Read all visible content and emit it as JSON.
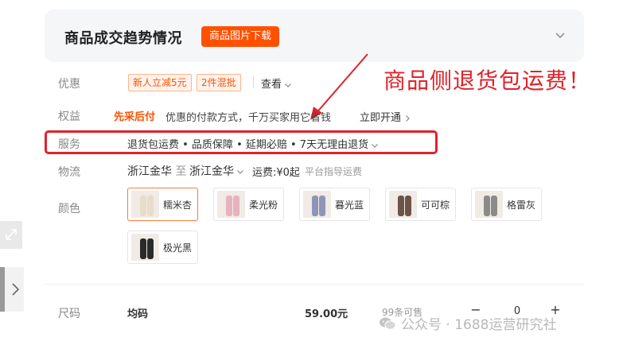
{
  "header": {
    "title": "商品成交趋势情况",
    "download_label": "商品图片下载"
  },
  "annotation": "商品侧退货包运费！",
  "rows": {
    "discount": {
      "label": "优惠",
      "tags": [
        "新人立减5元",
        "2件混批"
      ],
      "view_label": "查看"
    },
    "benefit": {
      "label": "权益",
      "name": "先采后付",
      "desc": "优惠的付款方式，千万买家用它省钱",
      "action": "立即开通"
    },
    "service": {
      "label": "服务",
      "text": "退货包运费 • 品质保障 • 延期必赔 • 7天无理由退货"
    },
    "logistics": {
      "label": "物流",
      "from": "浙江金华",
      "to_word": "至",
      "to": "浙江金华",
      "fee": "运费:¥0起",
      "fee_note": "平台指导运费"
    },
    "color": {
      "label": "颜色",
      "options": [
        {
          "name": "糯米杏",
          "tone": "#e8dccb"
        },
        {
          "name": "柔光粉",
          "tone": "#e7b2bf"
        },
        {
          "name": "暮光蓝",
          "tone": "#8f95b8"
        },
        {
          "name": "可可棕",
          "tone": "#6b5447"
        },
        {
          "name": "格雷灰",
          "tone": "#8b8b8b"
        },
        {
          "name": "极光黑",
          "tone": "#2a2a2a"
        }
      ]
    },
    "size": {
      "label": "尺码",
      "value": "均码",
      "price": "59.00元",
      "stock": "99条可售",
      "minus": "−",
      "quantity": "0",
      "plus": "+"
    }
  },
  "watermark": "公众号 · 1688运营研究社",
  "colors": {
    "accent": "#ff5000",
    "annotation_red": "#e0222a"
  }
}
